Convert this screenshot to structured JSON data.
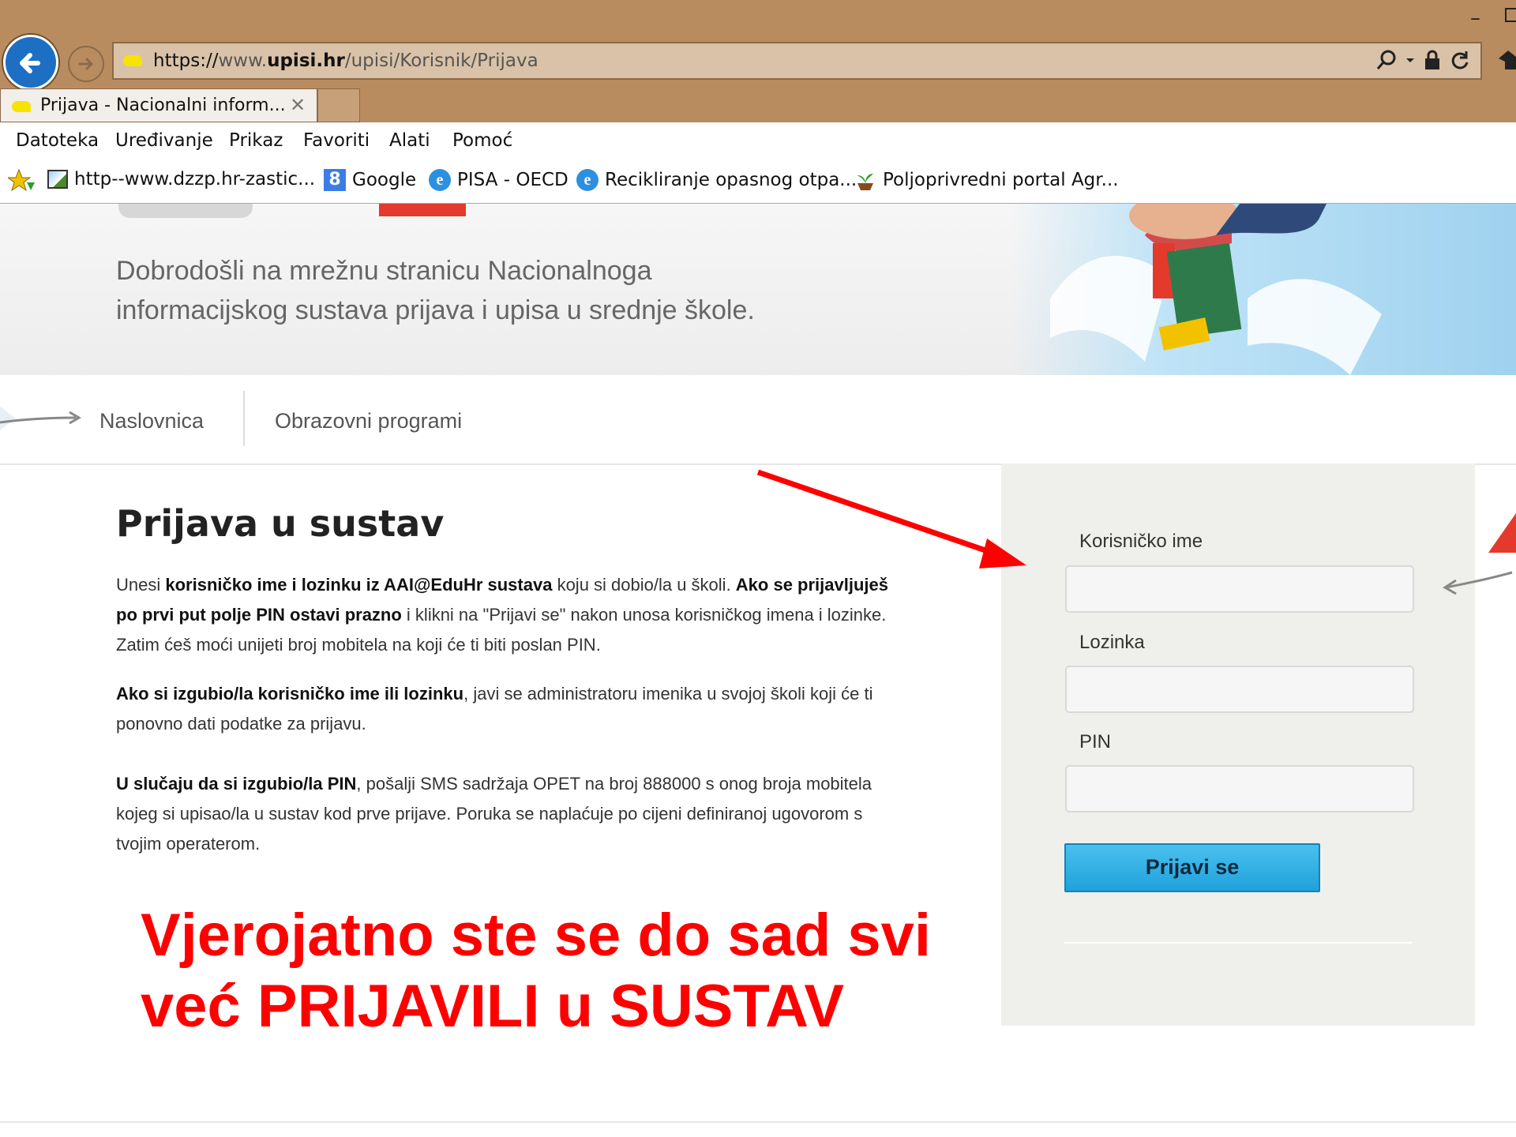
{
  "browser": {
    "url_scheme": "https://",
    "url_prefix": "www.",
    "url_host": "upisi.hr",
    "url_path": "/upisi/Korisnik/Prijava",
    "tab_title": "Prijava - Nacionalni inform...",
    "tab_close": "✕",
    "window_minimize": "–"
  },
  "menu": [
    "Datoteka",
    "Uređivanje",
    "Prikaz",
    "Favoriti",
    "Alati",
    "Pomoć"
  ],
  "favorites": [
    {
      "label": "http--www.dzzp.hr-zastic...",
      "icon": "image-icon"
    },
    {
      "label": "Google",
      "icon": "google-icon",
      "glyph": "8"
    },
    {
      "label": "PISA - OECD",
      "icon": "ie-icon",
      "glyph": "e"
    },
    {
      "label": "Recikliranje opasnog otpa...",
      "icon": "ie-icon",
      "glyph": "e"
    },
    {
      "label": "Poljoprivredni portal  Agr...",
      "icon": "plant-icon"
    }
  ],
  "banner": {
    "welcome_line1": "Dobrodošli na mrežnu stranicu Nacionalnoga",
    "welcome_line2": "informacijskog sustava prijava i upisa u srednje škole."
  },
  "nav": {
    "home": "Naslovnica",
    "programs": "Obrazovni programi"
  },
  "content": {
    "title": "Prijava u sustav",
    "p1": {
      "a": "Unesi ",
      "b": "korisničko ime i lozinku iz AAI@EduHr sustava",
      "c": " koju si dobio/la u školi. ",
      "d": "Ako se prijavljuješ po prvi put polje PIN ostavi prazno",
      "e": " i klikni na \"Prijavi se\" nakon unosa korisničkog imena i lozinke. Zatim ćeš moći unijeti broj mobitela na koji će ti biti poslan PIN."
    },
    "p2": {
      "b": "Ako si izgubio/la korisničko ime ili lozinku",
      "c": ", javi se administratoru imenika u svojoj školi koji će ti ponovno dati podatke za prijavu."
    },
    "p3": {
      "b": "U slučaju da si izgubio/la PIN",
      "c": ", pošalji SMS sadržaja OPET na broj 888000 s onog broja mobitela kojeg si upisao/la u sustav kod prve prijave. Poruka se naplaćuje po cijeni definiranoj ugovorom s tvojim operaterom."
    }
  },
  "login": {
    "username_label": "Korisničko ime",
    "username_value": "",
    "password_label": "Lozinka",
    "password_value": "",
    "pin_label": "PIN",
    "pin_value": "",
    "submit": "Prijavi se"
  },
  "annotation": {
    "line1": "Vjerojatno ste se do sad svi",
    "line2": "već PRIJAVILI u SUSTAV",
    "color": "#ff0000"
  }
}
